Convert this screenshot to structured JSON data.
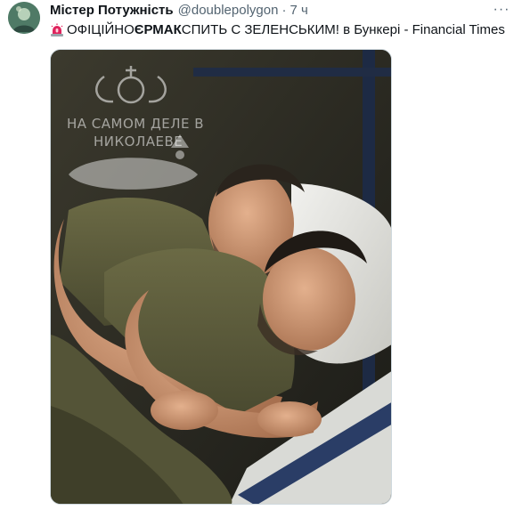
{
  "tweet": {
    "display_name": "Містер Потужність",
    "handle": "@doublepolygon",
    "separator": "·",
    "time": "7 ч",
    "more_label": "···",
    "text_part1": "ОФІЦІЙНО ",
    "text_bold": "ЄРМАК",
    "text_part2": " СПИТЬ С ЗЕЛЕНСЬКИМ! в Бункері - Financial Times"
  },
  "media": {
    "watermark_line1": "НА САМОМ ДЕЛЕ В",
    "watermark_line2": "НИКОЛАЕВЕ"
  },
  "icons": {
    "avatar": "avatar-image",
    "siren": "siren-emoji-icon",
    "more": "more-options-icon"
  },
  "colors": {
    "text_primary": "#0f1419",
    "text_secondary": "#536471",
    "siren_red": "#e0245e"
  }
}
